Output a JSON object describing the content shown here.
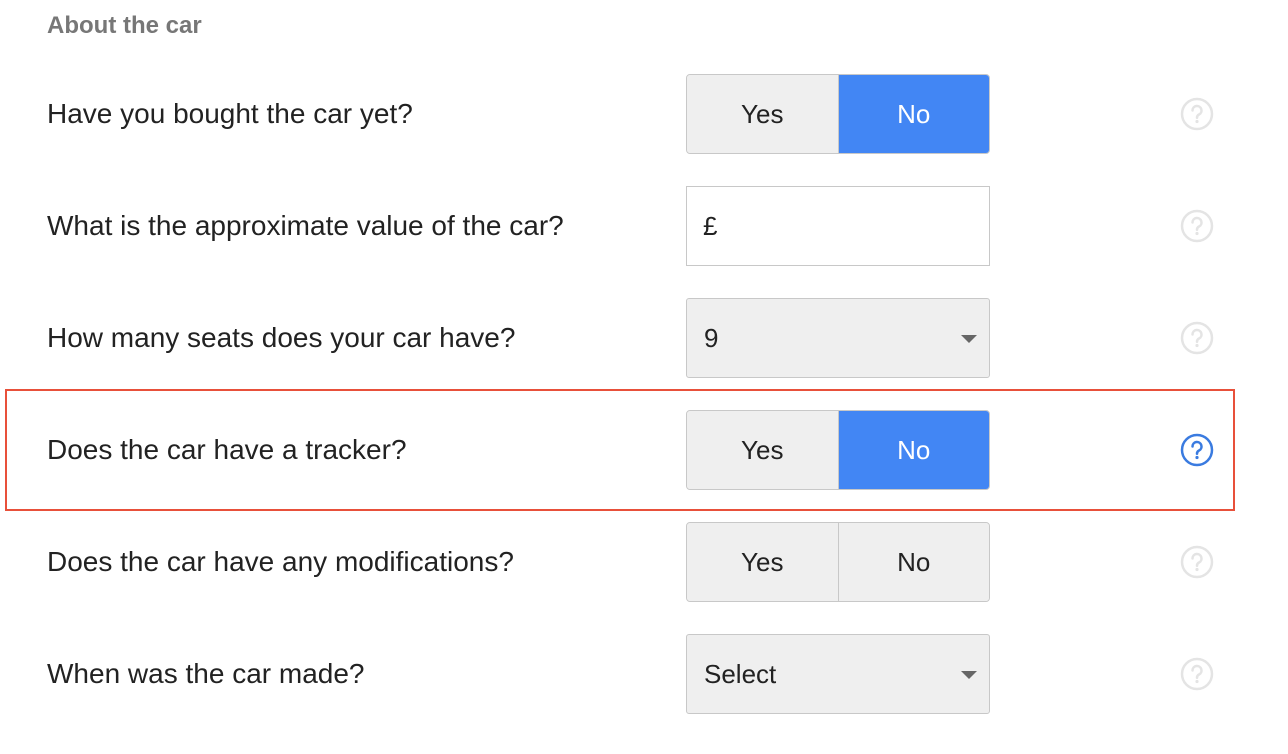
{
  "section": {
    "title": "About the car"
  },
  "rows": [
    {
      "question": "Have you bought the car yet?",
      "type": "toggle",
      "options": [
        "Yes",
        "No"
      ],
      "selected": "No"
    },
    {
      "question": "What is the approximate value of the car?",
      "type": "currency-input",
      "prefix": "£",
      "value": "",
      "placeholder": ""
    },
    {
      "question": "How many seats does your car have?",
      "type": "select",
      "value": "9"
    },
    {
      "question": "Does the car have a tracker?",
      "type": "toggle",
      "options": [
        "Yes",
        "No"
      ],
      "selected": "No",
      "highlighted": true
    },
    {
      "question": "Does the car have any modifications?",
      "type": "toggle",
      "options": [
        "Yes",
        "No"
      ],
      "selected": null
    },
    {
      "question": "When was the car made?",
      "type": "select",
      "value": "Select"
    }
  ],
  "colors": {
    "accent": "#4286f4",
    "highlight_outline": "#e8503a",
    "help_inactive": "#e4e4e4",
    "help_active": "#3a7be0",
    "control_bg": "#efefef",
    "control_border": "#c8c8c8"
  },
  "icons": {
    "help": "question-circle-icon",
    "caret": "chevron-down-icon"
  }
}
